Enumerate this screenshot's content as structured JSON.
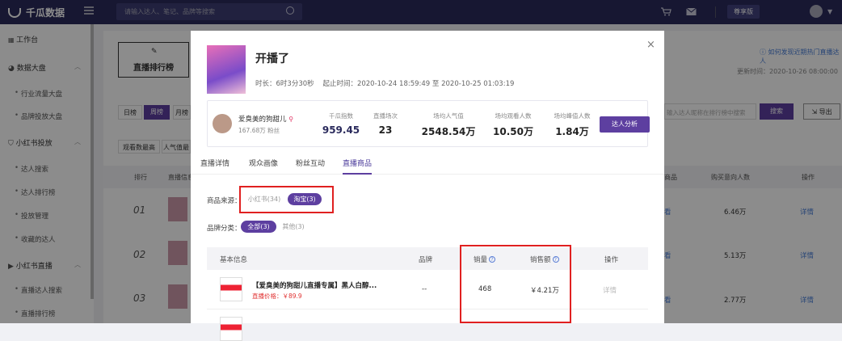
{
  "header": {
    "brand": "千瓜数据",
    "search_placeholder": "请输入达人、笔记、品牌等搜索",
    "vip_label": "尊享版"
  },
  "sidebar": {
    "items": [
      {
        "label": "工作台",
        "type": "head"
      },
      {
        "label": "数据大盘",
        "type": "head"
      },
      {
        "label": "行业流量大盘",
        "type": "sub"
      },
      {
        "label": "品牌投放大盘",
        "type": "sub"
      },
      {
        "label": "小红书投放",
        "type": "head"
      },
      {
        "label": "达人搜索",
        "type": "sub"
      },
      {
        "label": "达人排行榜",
        "type": "sub"
      },
      {
        "label": "投放管理",
        "type": "sub"
      },
      {
        "label": "收藏的达人",
        "type": "sub"
      },
      {
        "label": "小红书直播",
        "type": "head"
      },
      {
        "label": "直播达人搜索",
        "type": "sub"
      },
      {
        "label": "直播排行榜",
        "type": "sub"
      }
    ]
  },
  "background": {
    "tab_label": "直播排行榜",
    "help_link": "如何发现近期热门直播达人",
    "update_time": "更新时间：2020-10-26 08:00:00",
    "periods": [
      "日榜",
      "周榜",
      "月榜"
    ],
    "filters": [
      "观看数最高",
      "人气值最"
    ],
    "search_placeholder": "输入达人昵称在排行榜中搜索",
    "search_btn": "搜索",
    "export_btn": "导出",
    "col_rank": "排行",
    "col_info": "直播信息",
    "col_goods": "商品",
    "col_buyers": "购买意向人数",
    "col_action": "操作",
    "rows": [
      {
        "rank": "01",
        "buyers": "6.46万",
        "action": "详情",
        "goods": "看"
      },
      {
        "rank": "02",
        "buyers": "5.13万",
        "action": "详情",
        "goods": "看"
      },
      {
        "rank": "03",
        "buyers": "2.77万",
        "action": "详情",
        "goods": "看"
      }
    ]
  },
  "modal": {
    "close": "×",
    "title": "开播了",
    "meta": "时长：6时3分30秒    起止时间：2020-10-24 18:59:49 至 2020-10-25 01:03:19",
    "anchor_name": "爱臭美的狗甜儿",
    "anchor_fans": "167.68万 粉丝",
    "stats": [
      {
        "label": "千瓜指数",
        "value": "959.45",
        "accent": true
      },
      {
        "label": "直播场次",
        "value": "23"
      },
      {
        "label": "场均人气值",
        "value": "2548.54万"
      },
      {
        "label": "场均观看人数",
        "value": "10.50万"
      },
      {
        "label": "场均峰值人数",
        "value": "1.84万"
      }
    ],
    "analyze_btn": "达人分析",
    "tabs": [
      "直播详情",
      "观众画像",
      "粉丝互动",
      "直播商品"
    ],
    "source_label": "商品来源：",
    "source_options": [
      {
        "label": "小红书(34)",
        "active": false
      },
      {
        "label": "淘宝(3)",
        "active": true
      }
    ],
    "brand_label": "品牌分类：",
    "brand_options": [
      {
        "label": "全部(3)",
        "active": true
      },
      {
        "label": "其他(3)",
        "active": false
      }
    ],
    "table_headers": {
      "info": "基本信息",
      "brand": "品牌",
      "sales": "销量",
      "amount": "销售额",
      "action": "操作"
    },
    "products": [
      {
        "name": "【爱臭美的狗甜儿直播专属】黑人白醇...",
        "price": "直播价格：￥89.9",
        "brand": "--",
        "sales": "468",
        "amount": "￥4.21万",
        "action": "详情"
      }
    ]
  }
}
